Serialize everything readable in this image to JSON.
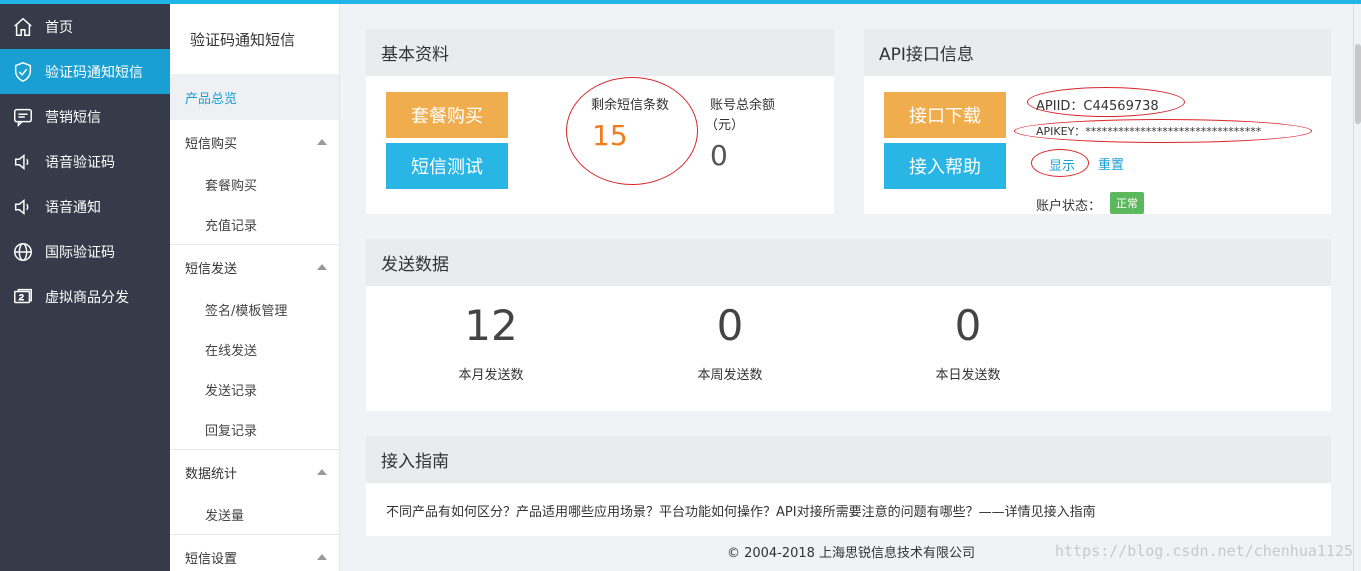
{
  "nav": {
    "items": [
      {
        "label": "首页",
        "icon": "home-icon",
        "active": false
      },
      {
        "label": "验证码通知短信",
        "icon": "shield-icon",
        "active": true
      },
      {
        "label": "营销短信",
        "icon": "message-icon",
        "active": false
      },
      {
        "label": "语音验证码",
        "icon": "speaker-icon",
        "active": false
      },
      {
        "label": "语音通知",
        "icon": "speaker-icon",
        "active": false
      },
      {
        "label": "国际验证码",
        "icon": "globe-icon",
        "active": false
      },
      {
        "label": "虚拟商品分发",
        "icon": "ticket-icon",
        "active": false
      }
    ]
  },
  "subnav": {
    "title": "验证码通知短信",
    "overview": "产品总览",
    "groups": [
      {
        "label": "短信购买",
        "links": [
          "套餐购买",
          "充值记录"
        ]
      },
      {
        "label": "短信发送",
        "links": [
          "签名/模板管理",
          "在线发送",
          "发送记录",
          "回复记录"
        ]
      },
      {
        "label": "数据统计",
        "links": [
          "发送量"
        ]
      },
      {
        "label": "短信设置",
        "links": []
      }
    ]
  },
  "basic": {
    "title": "基本资料",
    "buy_button": "套餐购买",
    "test_button": "短信测试",
    "remain_label": "剩余短信条数",
    "remain_value": "15",
    "balance_label_1": "账号总余额",
    "balance_label_2": "（元）",
    "balance_value": "0"
  },
  "api": {
    "title": "API接口信息",
    "download_button": "接口下载",
    "help_button": "接入帮助",
    "apiid": "APIID：C44569738",
    "apikey": "APIKEY：********************************",
    "show_link": "显示",
    "reset_link": "重置",
    "status_label": "账户状态：",
    "status_value": "正常"
  },
  "send": {
    "title": "发送数据",
    "stats": [
      {
        "value": "12",
        "label": "本月发送数"
      },
      {
        "value": "0",
        "label": "本周发送数"
      },
      {
        "value": "0",
        "label": "本日发送数"
      }
    ]
  },
  "guide": {
    "title": "接入指南",
    "text": "不同产品有如何区分？产品适用哪些应用场景？平台功能如何操作？API对接所需要注意的问题有哪些？——详情见接入指南"
  },
  "footer": {
    "copyright": "© 2004-2018 上海思锐信息技术有限公司",
    "watermark": "https://blog.csdn.net/chenhua1125"
  },
  "colors": {
    "accent": "#1a9fd3",
    "orange_button": "#f0ad4e",
    "blue_button": "#2ab6e4",
    "nav_bg": "#353b48",
    "annotation_red": "#d9262b",
    "status_green": "#5cb85c"
  }
}
